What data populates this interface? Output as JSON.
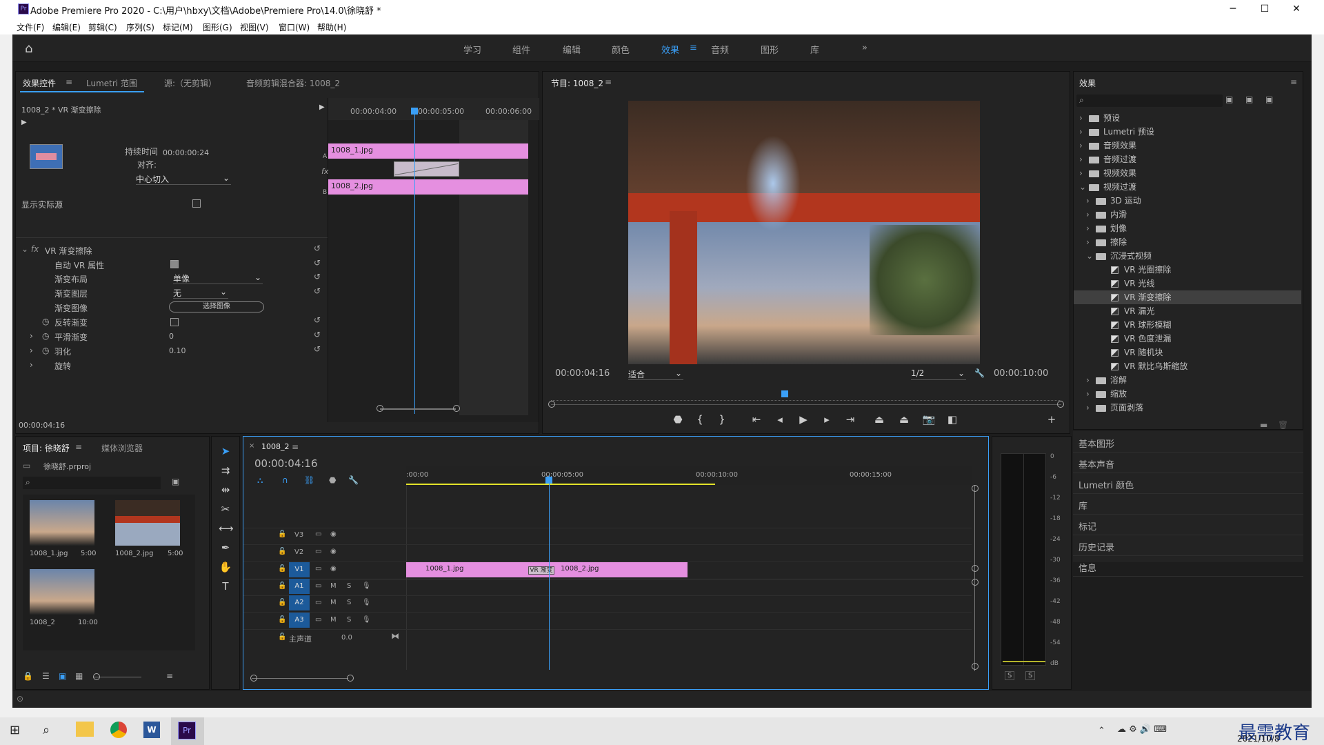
{
  "window": {
    "title": "Adobe Premiere Pro 2020 - C:\\用户\\hbxy\\文档\\Adobe\\Premiere Pro\\14.0\\徐晓舒 *",
    "app_icon": "Pr"
  },
  "menu": [
    "文件(F)",
    "编辑(E)",
    "剪辑(C)",
    "序列(S)",
    "标记(M)",
    "图形(G)",
    "视图(V)",
    "窗口(W)",
    "帮助(H)"
  ],
  "workspaces": {
    "items": [
      "学习",
      "组件",
      "编辑",
      "颜色",
      "效果",
      "音频",
      "图形",
      "库"
    ],
    "active": "效果",
    "more": "»"
  },
  "effect_controls": {
    "tabs": [
      "效果控件",
      "Lumetri 范围",
      "源:（无剪辑）",
      "音频剪辑混合器: 1008_2"
    ],
    "clip_header": "1008_2 * VR 渐变擦除",
    "timecodes": [
      "00:00:04:00",
      "00:00:05:00",
      "00:00:06:00"
    ],
    "clip_a": "1008_1.jpg",
    "clip_b": "1008_2.jpg",
    "track_a": "A",
    "track_b": "B",
    "fx": "fx",
    "duration_label": "持续时间",
    "duration_value": "00:00:00:24",
    "align_label": "对齐:",
    "align_value": "中心切入",
    "show_actual_source": "显示实际源",
    "effect_name": "VR 渐变擦除",
    "props": [
      {
        "name": "自动 VR 属性",
        "type": "check",
        "value": "checked"
      },
      {
        "name": "渐变布局",
        "type": "select",
        "value": "单像"
      },
      {
        "name": "渐变图层",
        "type": "select",
        "value": "无"
      },
      {
        "name": "渐变图像",
        "type": "button",
        "value": "选择图像"
      },
      {
        "name": "反转渐变",
        "type": "check",
        "value": ""
      },
      {
        "name": "平滑渐变",
        "type": "num",
        "value": "0"
      },
      {
        "name": "羽化",
        "type": "num",
        "value": "0.10"
      },
      {
        "name": "旋转",
        "type": "none",
        "value": ""
      }
    ],
    "current_time": "00:00:04:16"
  },
  "program": {
    "title": "节目: 1008_2",
    "timecode": "00:00:04:16",
    "fit": "适合",
    "resolution": "1/2",
    "duration": "00:00:10:00"
  },
  "effects": {
    "title": "效果",
    "tree": [
      {
        "label": "预设",
        "level": 0,
        "kind": "folder",
        "open": false
      },
      {
        "label": "Lumetri 预设",
        "level": 0,
        "kind": "folder",
        "open": false
      },
      {
        "label": "音频效果",
        "level": 0,
        "kind": "folder",
        "open": false
      },
      {
        "label": "音频过渡",
        "level": 0,
        "kind": "folder",
        "open": false
      },
      {
        "label": "视频效果",
        "level": 0,
        "kind": "folder",
        "open": false
      },
      {
        "label": "视频过渡",
        "level": 0,
        "kind": "folder",
        "open": true
      },
      {
        "label": "3D 运动",
        "level": 1,
        "kind": "folder",
        "open": false
      },
      {
        "label": "内滑",
        "level": 1,
        "kind": "folder",
        "open": false
      },
      {
        "label": "划像",
        "level": 1,
        "kind": "folder",
        "open": false
      },
      {
        "label": "擦除",
        "level": 1,
        "kind": "folder",
        "open": false
      },
      {
        "label": "沉浸式视频",
        "level": 1,
        "kind": "folder",
        "open": true
      },
      {
        "label": "VR 光圈擦除",
        "level": 2,
        "kind": "fx"
      },
      {
        "label": "VR 光线",
        "level": 2,
        "kind": "fx"
      },
      {
        "label": "VR 渐变擦除",
        "level": 2,
        "kind": "fx",
        "selected": true
      },
      {
        "label": "VR 漏光",
        "level": 2,
        "kind": "fx"
      },
      {
        "label": "VR 球形模糊",
        "level": 2,
        "kind": "fx"
      },
      {
        "label": "VR 色度泄漏",
        "level": 2,
        "kind": "fx"
      },
      {
        "label": "VR 随机块",
        "level": 2,
        "kind": "fx"
      },
      {
        "label": "VR 默比乌斯缩放",
        "level": 2,
        "kind": "fx"
      },
      {
        "label": "溶解",
        "level": 1,
        "kind": "folder",
        "open": false
      },
      {
        "label": "缩放",
        "level": 1,
        "kind": "folder",
        "open": false
      },
      {
        "label": "页面剥落",
        "level": 1,
        "kind": "folder",
        "open": false
      }
    ],
    "side_panels": [
      "基本图形",
      "基本声音",
      "Lumetri 颜色",
      "库",
      "标记",
      "历史记录",
      "信息"
    ]
  },
  "project": {
    "tabs": [
      "项目: 徐晓舒",
      "媒体浏览器"
    ],
    "file": "徐晓舒.prproj",
    "items": [
      {
        "name": "1008_1.jpg",
        "duration": "5:00"
      },
      {
        "name": "1008_2.jpg",
        "duration": "5:00"
      },
      {
        "name": "1008_2",
        "duration": "10:00"
      }
    ]
  },
  "timeline": {
    "tab": "1008_2",
    "timecode": "00:00:04:16",
    "ruler": [
      ":00:00",
      "00:00:05:00",
      "00:00:10:00",
      "00:00:15:00"
    ],
    "video_tracks": [
      "V3",
      "V2",
      "V1"
    ],
    "audio_tracks": [
      "A1",
      "A2",
      "A3"
    ],
    "master": "主声道",
    "master_value": "0.0",
    "clip1": "1008_1.jpg",
    "clip2": "1008_2.jpg",
    "transition": "VR 渐变"
  },
  "meter": {
    "scale": [
      "0",
      "-6",
      "-12",
      "-18",
      "-24",
      "-30",
      "-36",
      "-42",
      "-48",
      "-54",
      "dB"
    ],
    "solo": [
      "S",
      "S"
    ]
  },
  "taskbar": {
    "date": "2021/10/8",
    "watermark": "最需教育"
  }
}
